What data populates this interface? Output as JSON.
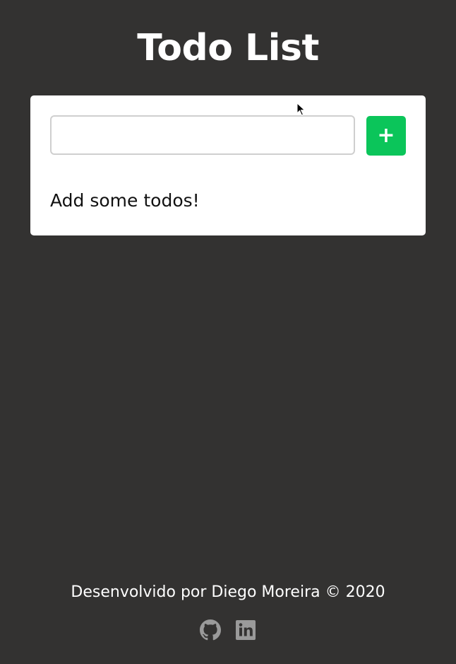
{
  "header": {
    "title": "Todo List"
  },
  "todo_form": {
    "input_value": "",
    "input_placeholder": "",
    "add_button_label": "+"
  },
  "todo_list": {
    "empty_message": "Add some todos!",
    "items": []
  },
  "footer": {
    "credit": "Desenvolvido por Diego Moreira © 2020",
    "social_icons": [
      "github-icon",
      "linkedin-icon"
    ]
  },
  "colors": {
    "background": "#333231",
    "card": "#ffffff",
    "accent": "#0bc55a",
    "icon": "#9a9a9a"
  }
}
